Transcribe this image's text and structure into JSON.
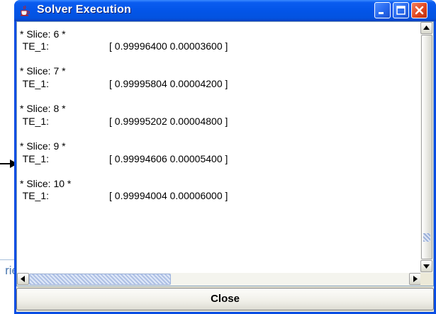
{
  "window": {
    "title": "Solver Execution",
    "icon": "java-cup-icon",
    "controls": {
      "minimize": "minimize-icon",
      "maximize": "maximize-icon",
      "close": "close-icon"
    }
  },
  "output": {
    "lines": [
      {
        "label": "",
        "value": ""
      },
      {
        "label": "* Slice: 6 *",
        "value": ""
      },
      {
        "label": " TE_1:",
        "value": "[ 0.99996400 0.00003600 ]"
      },
      {
        "label": "",
        "value": ""
      },
      {
        "label": "* Slice: 7 *",
        "value": ""
      },
      {
        "label": " TE_1:",
        "value": "[ 0.99995804 0.00004200 ]"
      },
      {
        "label": "",
        "value": ""
      },
      {
        "label": "* Slice: 8 *",
        "value": ""
      },
      {
        "label": " TE_1:",
        "value": "[ 0.99995202 0.00004800 ]"
      },
      {
        "label": "",
        "value": ""
      },
      {
        "label": "* Slice: 9 *",
        "value": ""
      },
      {
        "label": " TE_1:",
        "value": "[ 0.99994606 0.00005400 ]"
      },
      {
        "label": "",
        "value": ""
      },
      {
        "label": "* Slice: 10 *",
        "value": ""
      },
      {
        "label": " TE_1:",
        "value": "[ 0.99994004 0.00006000 ]"
      }
    ]
  },
  "scroll": {
    "vertical_position_fraction": 0.98,
    "horizontal_position_fraction": 0.0
  },
  "buttons": {
    "close_label": "Close"
  },
  "background": {
    "fragment_text": "rie"
  },
  "colors": {
    "titlebar": "#0355e8",
    "window_bg": "#ece9d8",
    "close_control": "#e04820"
  }
}
